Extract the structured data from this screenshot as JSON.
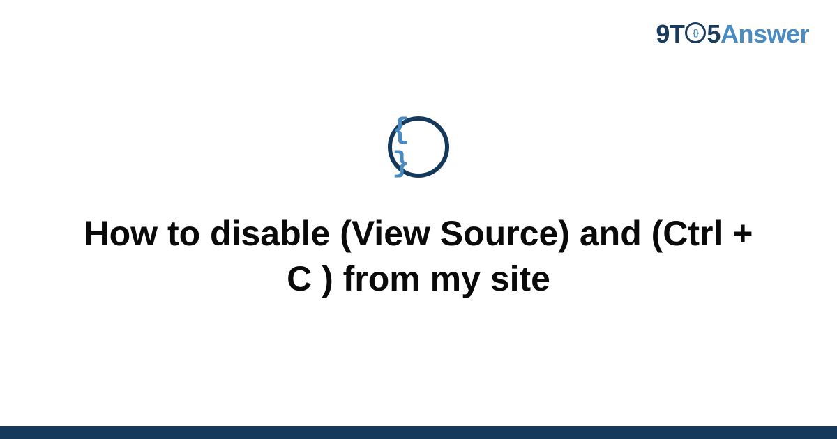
{
  "brand": {
    "prefix": "9T",
    "ring_inner": "{}",
    "suffix": "5",
    "word": "Answer"
  },
  "category_icon": {
    "name": "curly-braces-icon",
    "glyph": "{ }"
  },
  "title": "How to disable (View Source) and (Ctrl + C ) from my site",
  "colors": {
    "accent_dark": "#15395b",
    "accent_light": "#4a8bc2",
    "text": "#0a0a0a",
    "bg": "#ffffff"
  }
}
